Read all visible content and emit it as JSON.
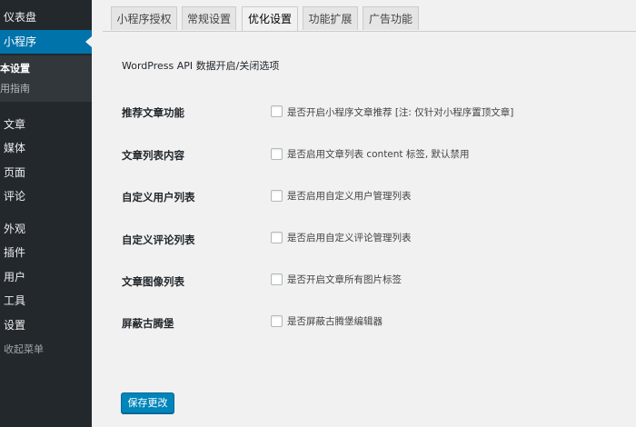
{
  "sidebar": {
    "items": [
      {
        "label": "仪表盘"
      },
      {
        "label": "小程序"
      },
      {
        "label": "本设置"
      },
      {
        "label": "用指南"
      },
      {
        "label": "文章"
      },
      {
        "label": "媒体"
      },
      {
        "label": "页面"
      },
      {
        "label": "评论"
      },
      {
        "label": "外观"
      },
      {
        "label": "插件"
      },
      {
        "label": "用户"
      },
      {
        "label": "工具"
      },
      {
        "label": "设置"
      },
      {
        "label": "收起菜单"
      }
    ]
  },
  "tabs": [
    {
      "label": "小程序授权"
    },
    {
      "label": "常规设置"
    },
    {
      "label": "优化设置"
    },
    {
      "label": "功能扩展"
    },
    {
      "label": "广告功能"
    }
  ],
  "section_title": "WordPress API 数据开启/关闭选项",
  "rows": [
    {
      "label": "推荐文章功能",
      "description": "是否开启小程序文章推荐 [注: 仅针对小程序置顶文章]",
      "checked": false
    },
    {
      "label": "文章列表内容",
      "description": "是否启用文章列表 content 标签, 默认禁用",
      "checked": false
    },
    {
      "label": "自定义用户列表",
      "description": "是否启用自定义用户管理列表",
      "checked": false
    },
    {
      "label": "自定义评论列表",
      "description": "是否启用自定义评论管理列表",
      "checked": false
    },
    {
      "label": "文章图像列表",
      "description": "是否开启文章所有图片标签",
      "checked": false
    },
    {
      "label": "屏蔽古腾堡",
      "description": "是否屏蔽古腾堡编辑器",
      "checked": false
    }
  ],
  "save_button": "保存更改",
  "colors": {
    "sidebar_bg": "#23282d",
    "active_menu": "#0073aa",
    "button_primary": "#0085ba",
    "page_bg": "#f1f1f1"
  }
}
